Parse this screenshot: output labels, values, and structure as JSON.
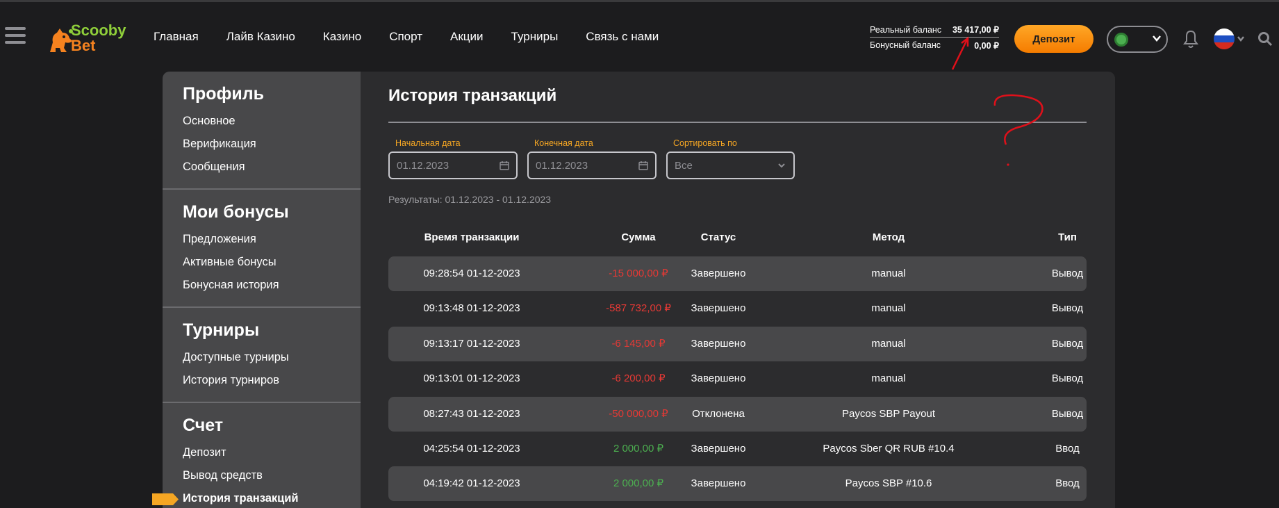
{
  "brand": {
    "line1": "Scooby",
    "line2": "Bet"
  },
  "nav": [
    "Главная",
    "Лайв Казино",
    "Казино",
    "Спорт",
    "Акции",
    "Турниры",
    "Связь с нами"
  ],
  "balances": {
    "real_label": "Реальный баланс",
    "real_value": "35 417,00 ₽",
    "bonus_label": "Бонусный баланс",
    "bonus_value": "0,00 ₽"
  },
  "deposit_button": "Депозит",
  "icons": {
    "menu": "hamburger-icon",
    "profile": "user-avatar-icon",
    "notifications": "bell-icon",
    "language": "russia-flag-icon",
    "search": "search-icon",
    "calendar": "calendar-icon",
    "dropdown": "chevron-down-icon"
  },
  "sidebar": [
    {
      "title": "Профиль",
      "items": [
        "Основное",
        "Верификация",
        "Сообщения"
      ]
    },
    {
      "title": "Мои бонусы",
      "items": [
        "Предложения",
        "Активные бонусы",
        "Бонусная история"
      ]
    },
    {
      "title": "Турниры",
      "items": [
        "Доступные турниры",
        "История турниров"
      ]
    },
    {
      "title": "Счет",
      "items": [
        "Депозит",
        "Вывод средств",
        "История транзакций"
      ]
    }
  ],
  "active_item": "История транзакций",
  "main": {
    "title": "История транзакций",
    "start_label": "Начальная дата",
    "start_value": "01.12.2023",
    "end_label": "Конечная дата",
    "end_value": "01.12.2023",
    "sort_label": "Сортировать по",
    "sort_value": "Все",
    "results": "Результаты: 01.12.2023 - 01.12.2023"
  },
  "table": {
    "columns": [
      "Время транзакции",
      "Сумма",
      "Статус",
      "Метод",
      "Тип"
    ],
    "rows": [
      {
        "time": "09:28:54 01-12-2023",
        "amount": "-15 000,00 ₽",
        "status": "Завершено",
        "method": "manual",
        "type": "Вывод"
      },
      {
        "time": "09:13:48 01-12-2023",
        "amount": "-587 732,00 ₽",
        "status": "Завершено",
        "method": "manual",
        "type": "Вывод"
      },
      {
        "time": "09:13:17 01-12-2023",
        "amount": "-6 145,00 ₽",
        "status": "Завершено",
        "method": "manual",
        "type": "Вывод"
      },
      {
        "time": "09:13:01 01-12-2023",
        "amount": "-6 200,00 ₽",
        "status": "Завершено",
        "method": "manual",
        "type": "Вывод"
      },
      {
        "time": "08:27:43 01-12-2023",
        "amount": "-50 000,00 ₽",
        "status": "Отклонена",
        "method": "Paycos SBP Payout",
        "type": "Вывод"
      },
      {
        "time": "04:25:54 01-12-2023",
        "amount": "2 000,00 ₽",
        "status": "Завершено",
        "method": "Paycos Sber QR RUB #10.4",
        "type": "Ввод"
      },
      {
        "time": "04:19:42 01-12-2023",
        "amount": "2 000,00 ₽",
        "status": "Завершено",
        "method": "Paycos SBP #10.6",
        "type": "Ввод"
      }
    ]
  },
  "colors": {
    "accent": "#f5a623",
    "negative": "#e53935",
    "positive": "#4caf50",
    "annotation": "#e0101a"
  }
}
